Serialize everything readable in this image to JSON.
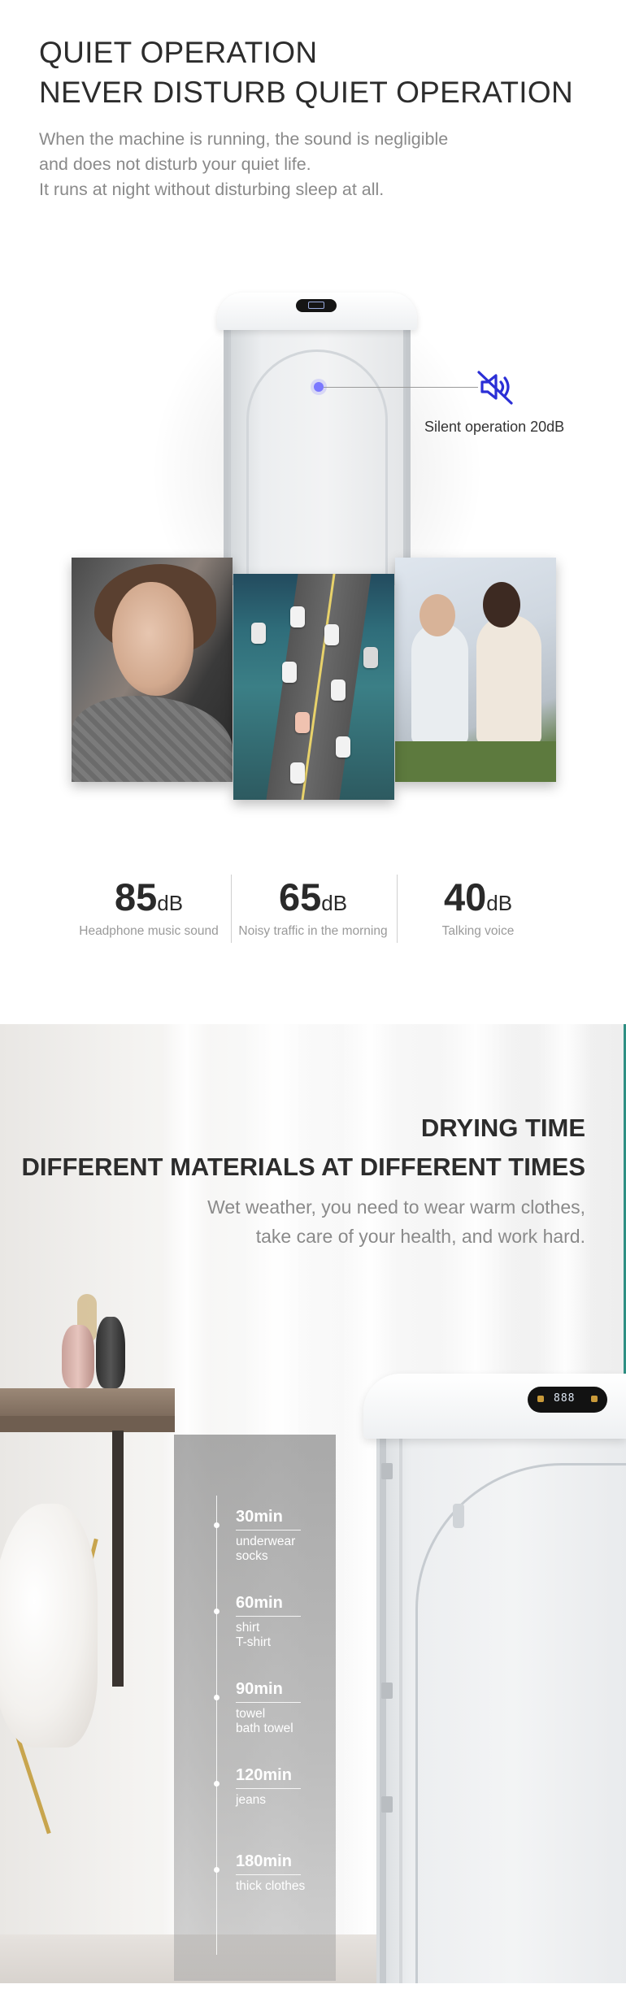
{
  "quiet": {
    "title_line1": "QUIET OPERATION",
    "title_line2": "NEVER DISTURB QUIET OPERATION",
    "desc_lines": [
      "When the machine is running, the sound is negligible",
      "and does not disturb your quiet life.",
      "It runs at night without disturbing sleep at all."
    ],
    "callout_label": "Silent operation 20dB",
    "accent_color": "#2b2fd6",
    "icons": {
      "callout": "muted-speaker-icon",
      "machine_display": "display-icon"
    },
    "photos": [
      {
        "subject": "woman-with-headphones-photo"
      },
      {
        "subject": "city-traffic-photo"
      },
      {
        "subject": "couple-talking-photo"
      }
    ],
    "db_levels": [
      {
        "value": "85",
        "unit": "dB",
        "caption": "Headphone music sound"
      },
      {
        "value": "65",
        "unit": "dB",
        "caption": "Noisy traffic in the morning"
      },
      {
        "value": "40",
        "unit": "dB",
        "caption": "Talking voice"
      }
    ]
  },
  "drying": {
    "title_line1": "DRYING TIME",
    "title_line2": "DIFFERENT MATERIALS AT DIFFERENT TIMES",
    "desc_lines": [
      "Wet weather, you need to wear warm clothes,",
      "take care of your health, and work hard."
    ],
    "display_digits": "888",
    "timeline": [
      {
        "time": "30min",
        "items": [
          "underwear",
          "socks"
        ]
      },
      {
        "time": "60min",
        "items": [
          "shirt",
          "T-shirt"
        ]
      },
      {
        "time": "90min",
        "items": [
          "towel",
          "bath towel"
        ]
      },
      {
        "time": "120min",
        "items": [
          "jeans"
        ]
      },
      {
        "time": "180min",
        "items": [
          "thick clothes"
        ]
      }
    ]
  }
}
